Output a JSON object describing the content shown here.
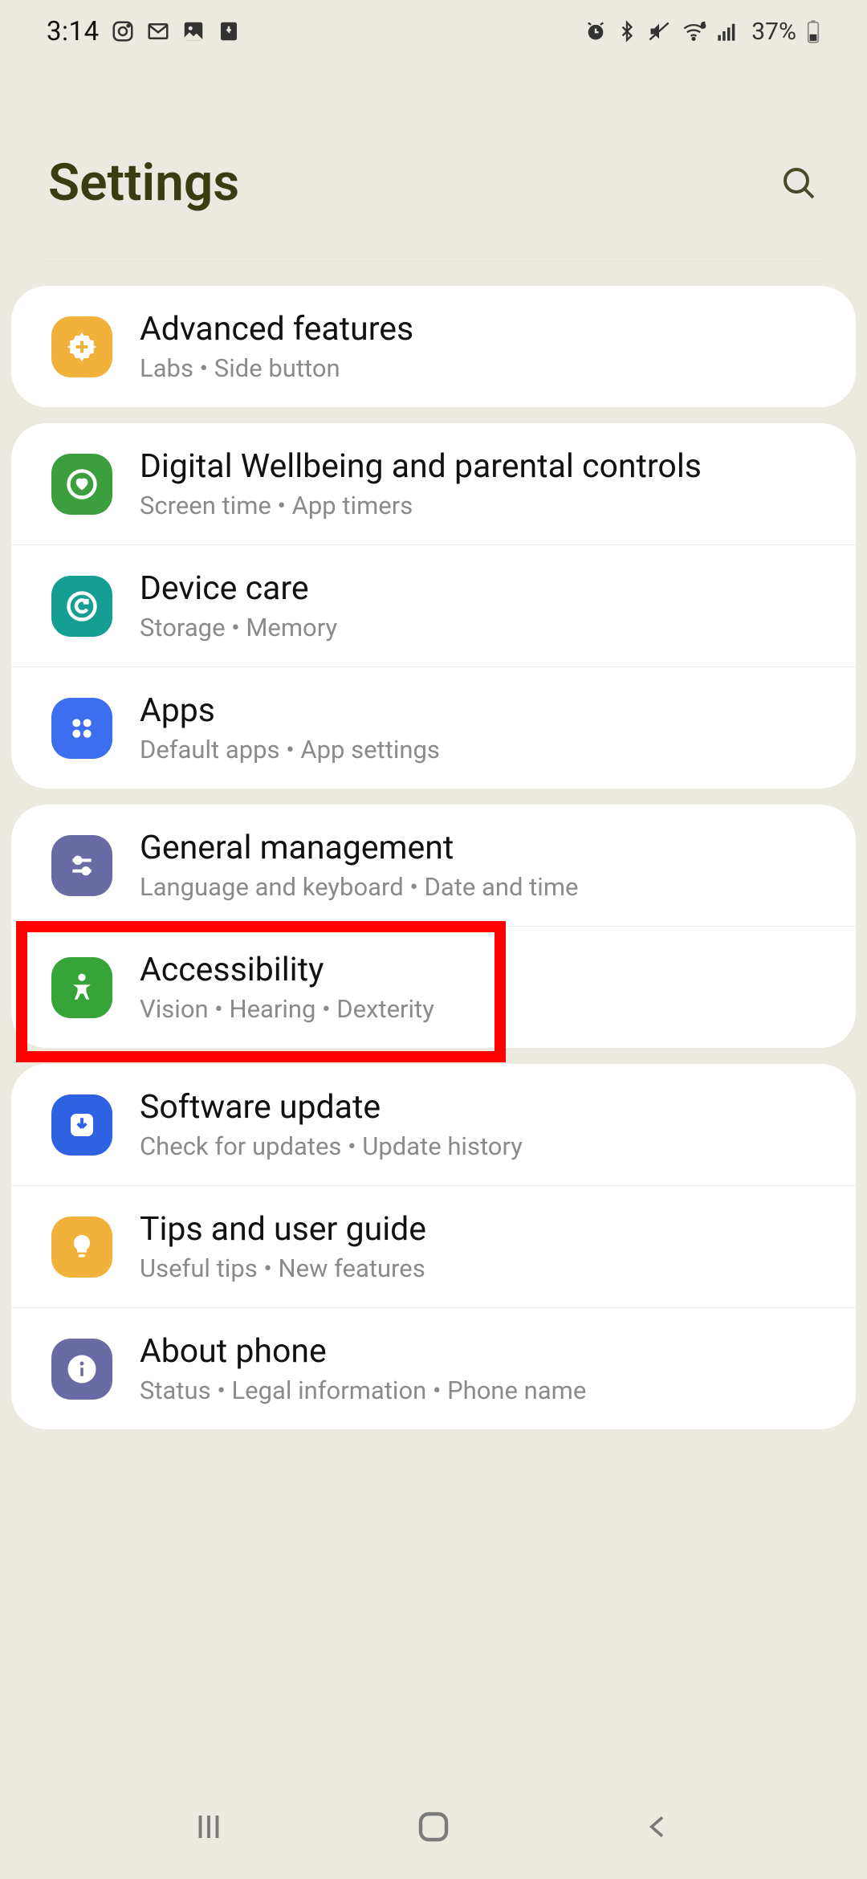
{
  "status": {
    "time": "3:14",
    "icons_left": [
      "instagram-icon",
      "gmail-icon",
      "photos-icon",
      "update-icon"
    ],
    "icons_right": [
      "alarm-icon",
      "bluetooth-icon",
      "mute-icon",
      "wifi-icon",
      "signal-icon"
    ],
    "battery_pct": "37%"
  },
  "header": {
    "title": "Settings"
  },
  "groups": [
    {
      "rows": [
        {
          "id": "advanced-features",
          "title": "Advanced features",
          "sub": "Labs  •  Side button",
          "icon": "cog-plus-icon",
          "bg": "#f2b13a",
          "fg": "#fff"
        }
      ]
    },
    {
      "rows": [
        {
          "id": "digital-wellbeing",
          "title": "Digital Wellbeing and parental controls",
          "sub": "Screen time  •  App timers",
          "icon": "heart-circle-icon",
          "bg": "#3c9f3e",
          "fg": "#fff"
        },
        {
          "id": "device-care",
          "title": "Device care",
          "sub": "Storage  •  Memory",
          "icon": "refresh-circle-icon",
          "bg": "#159f93",
          "fg": "#fff"
        },
        {
          "id": "apps",
          "title": "Apps",
          "sub": "Default apps  •  App settings",
          "icon": "apps-grid-icon",
          "bg": "#3d6ef0",
          "fg": "#fff"
        }
      ]
    },
    {
      "rows": [
        {
          "id": "general-management",
          "title": "General management",
          "sub": "Language and keyboard  •  Date and time",
          "icon": "sliders-icon",
          "bg": "#6a6aa4",
          "fg": "#fff"
        },
        {
          "id": "accessibility",
          "title": "Accessibility",
          "sub": "Vision  •  Hearing  •  Dexterity",
          "icon": "person-icon",
          "bg": "#37a43a",
          "fg": "#fff",
          "highlight": true
        }
      ]
    },
    {
      "rows": [
        {
          "id": "software-update",
          "title": "Software update",
          "sub": "Check for updates  •  Update history",
          "icon": "download-circle-icon",
          "bg": "#2f62e2",
          "fg": "#fff"
        },
        {
          "id": "tips",
          "title": "Tips and user guide",
          "sub": "Useful tips  •  New features",
          "icon": "lightbulb-icon",
          "bg": "#f2b13a",
          "fg": "#fff"
        },
        {
          "id": "about-phone",
          "title": "About phone",
          "sub": "Status  •  Legal information  •  Phone name",
          "icon": "info-icon",
          "bg": "#6a6aa4",
          "fg": "#fff"
        }
      ]
    }
  ],
  "nav": [
    "recents",
    "home",
    "back"
  ]
}
